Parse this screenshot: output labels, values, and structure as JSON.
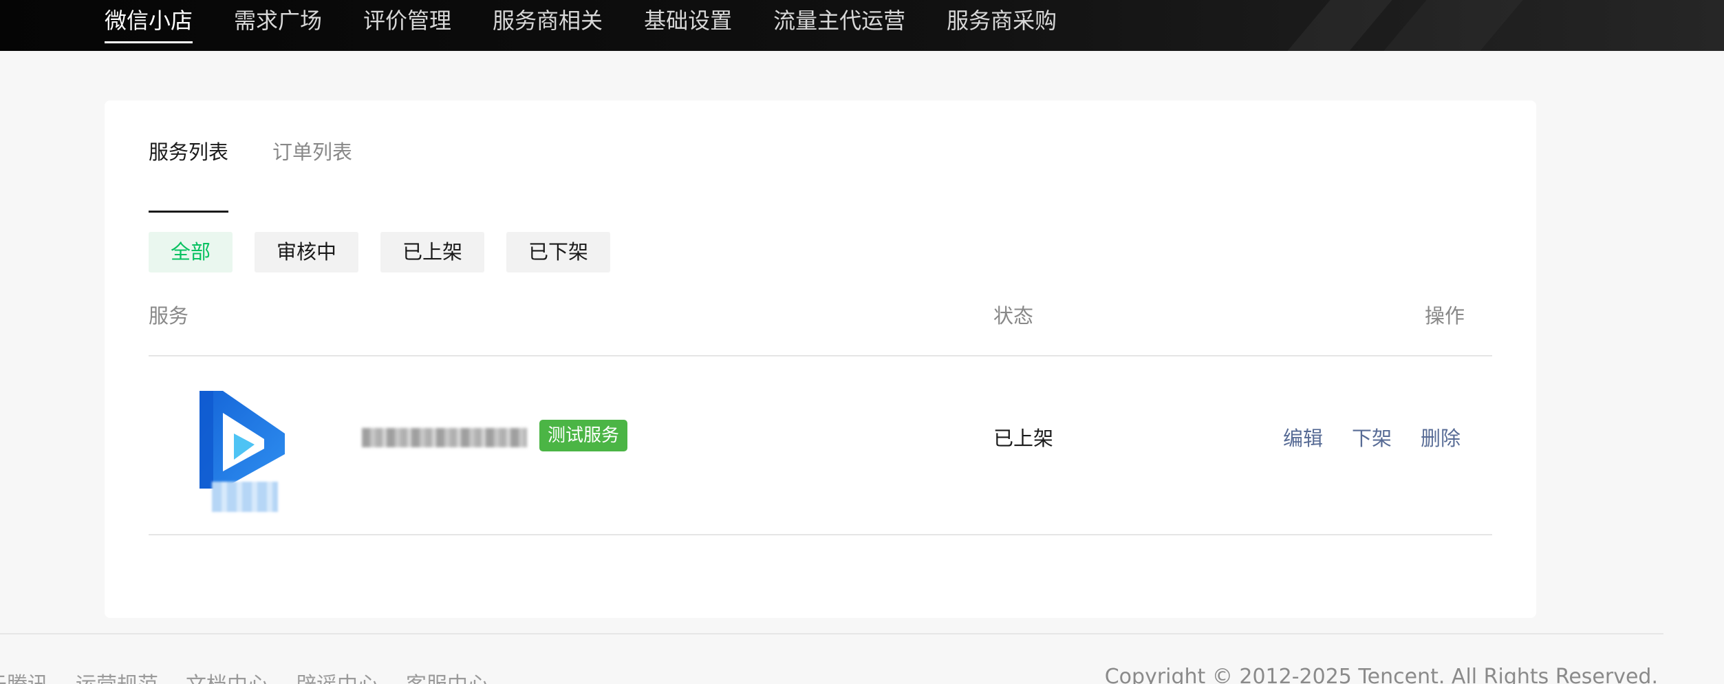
{
  "nav": {
    "items": [
      {
        "label": "微信小店",
        "active": true
      },
      {
        "label": "需求广场"
      },
      {
        "label": "评价管理"
      },
      {
        "label": "服务商相关"
      },
      {
        "label": "基础设置"
      },
      {
        "label": "流量主代运营"
      },
      {
        "label": "服务商采购"
      }
    ]
  },
  "tabs": [
    {
      "label": "服务列表",
      "active": true
    },
    {
      "label": "订单列表"
    }
  ],
  "filters": [
    {
      "label": "全部",
      "active": true
    },
    {
      "label": "审核中"
    },
    {
      "label": "已上架"
    },
    {
      "label": "已下架"
    }
  ],
  "table": {
    "headers": {
      "service": "服务",
      "status": "状态",
      "ops": "操作"
    },
    "rows": [
      {
        "badge": "测试服务",
        "status": "已上架",
        "actions": {
          "edit": "编辑",
          "unlist": "下架",
          "delete": "删除"
        }
      }
    ]
  },
  "footer": {
    "links": [
      "于腾讯",
      "运营规范",
      "文档中心",
      "辟谣中心",
      "客服中心"
    ],
    "copyright": "Copyright © 2012-2025 Tencent. All Rights Reserved."
  },
  "colors": {
    "accent_green": "#07c160",
    "badge_green": "#4bb545",
    "link_blue": "#576b95",
    "topbar": "#111111"
  }
}
